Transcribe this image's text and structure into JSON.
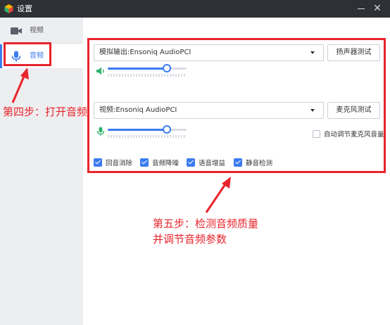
{
  "window": {
    "title": "设置"
  },
  "sidebar": {
    "items": [
      {
        "label": "视频",
        "icon": "video-camera-icon",
        "selected": false
      },
      {
        "label": "音频",
        "icon": "microphone-icon",
        "selected": true
      }
    ]
  },
  "audio": {
    "speaker": {
      "device": "模拟输出:Ensoniq AudioPCI",
      "test_button": "扬声器测试",
      "volume": 0.75
    },
    "microphone": {
      "device": "视频:Ensoniq AudioPCI",
      "test_button": "麦克风测试",
      "volume": 0.75,
      "auto_adjust_label": "自动调节麦克风音量",
      "auto_adjust_checked": false
    },
    "options": [
      {
        "label": "回音消除",
        "checked": true
      },
      {
        "label": "音频降噪",
        "checked": true
      },
      {
        "label": "语音增益",
        "checked": true
      },
      {
        "label": "静音检测",
        "checked": true
      }
    ]
  },
  "annotations": {
    "step4": "第四步：打开音频",
    "step5_line1": "第五步：检测音频质量",
    "step5_line2": "并调节音频参数"
  },
  "colors": {
    "accent": "#3c7cf0",
    "annotation": "#e8242c",
    "titlebar": "#2e3035",
    "sidebar": "#edeef0",
    "mic_icon": "#2fb36b",
    "speaker_icon": "#2fb36b"
  }
}
